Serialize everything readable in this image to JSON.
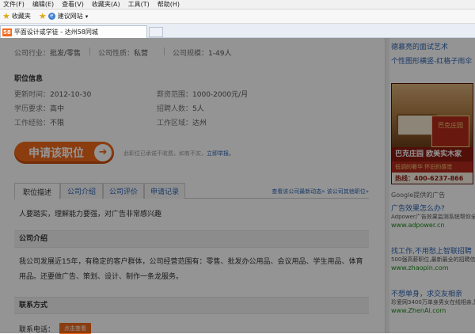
{
  "browser": {
    "menu": [
      "文件(F)",
      "编辑(E)",
      "查看(V)",
      "收藏夹(A)",
      "工具(T)",
      "帮助(H)"
    ],
    "favorites_label": "收藏夹",
    "suggested_sites": "建议网站",
    "tab_favicon": "58",
    "tab_title": "平面设计或学徒 - 达州58同城"
  },
  "company": {
    "industry_label": "公司行业：",
    "industry": "批发/零售",
    "nature_label": "公司性质：",
    "nature": "私营",
    "size_label": "公司规模：",
    "size": "1-49人"
  },
  "job_info": {
    "title": "职位信息",
    "updated_label": "更新时间：",
    "updated": "2012-10-30",
    "salary_label": "薪资范围：",
    "salary": "1000-2000元/月",
    "education_label": "学历要求：",
    "education": "高中",
    "headcount_label": "招聘人数：",
    "headcount": "5人",
    "experience_label": "工作经验：",
    "experience": "不限",
    "area_label": "工作区域：",
    "area": "达州"
  },
  "apply": {
    "button": "申请该职位",
    "notice": "此职位已承诺不收费，如有不实，",
    "report": "立即举报。"
  },
  "tabs": [
    "职位描述",
    "公司介绍",
    "公司评价",
    "申请记录"
  ],
  "tab_links": "查看该公司最新动态» 该公司其他职位»",
  "requirements": "人要踏实，理解能力要强，对广告非常感兴趣",
  "company_intro": {
    "title": "公司介绍",
    "text": "我公司发展近15年，有稳定的客户群体，公司经营范围有：零售、批发办公用品、会议用品、学生用品、体育用品。还要做广告、策划、设计、制作一条龙服务。"
  },
  "contact": {
    "title": "联系方式",
    "phone_label": "联系电话：",
    "phone_button": "点击查看"
  },
  "sidebar": {
    "link1": "德慕亮的面试艺术",
    "link2": "个性图形横竖-红格子雨伞",
    "ad": {
      "logo_text": "巴克庄园",
      "brand": "巴克庄园  欧美实木家",
      "slogan": "低调的奢华 怀旧的感觉",
      "phone": "热线：400-6237-866"
    },
    "google_label": "Google提供的广告",
    "ads": [
      {
        "title": "广告效果怎么办?",
        "desc": "Adpower广告效果监测系统帮你全面提高广告效果,降低广告成本",
        "url": "www.adpower.cn"
      },
      {
        "title": "找工作,不用愁上智联招聘",
        "desc": "500强高薪职位,最新最全的招聘信息,马上注册,简历轻松写,工作更好找",
        "url": "www.zhaopin.com"
      },
      {
        "title": "不想单身，求交友相亲",
        "desc": "珍爱网3400万单身男女在线相亲,靠谱多，单身，快来找对象",
        "url": "www.ZhenAi.com"
      }
    ]
  }
}
